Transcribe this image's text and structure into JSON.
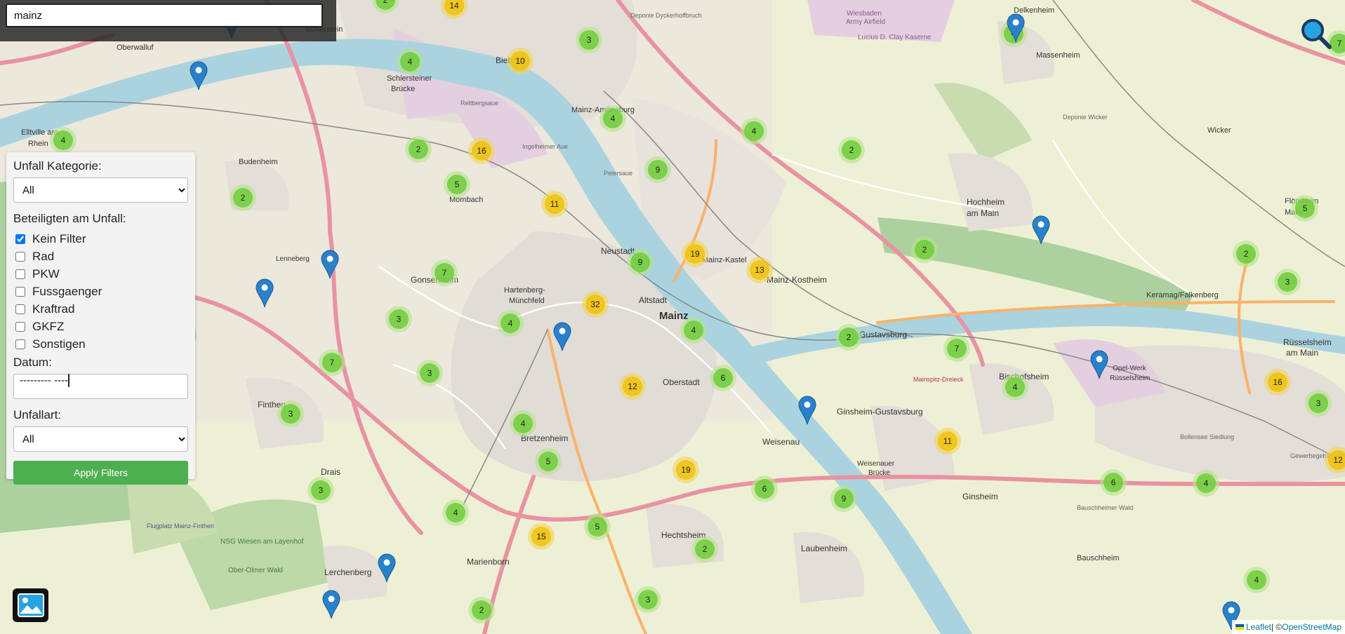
{
  "search": {
    "value": "mainz"
  },
  "filters": {
    "category_label": "Unfall Kategorie:",
    "category_value": "All",
    "participants_label": "Beteiligten am Unfall:",
    "participants": [
      {
        "label": "Kein Filter",
        "checked": true
      },
      {
        "label": "Rad",
        "checked": false
      },
      {
        "label": "PKW",
        "checked": false
      },
      {
        "label": "Fussgaenger",
        "checked": false
      },
      {
        "label": "Kraftrad",
        "checked": false
      },
      {
        "label": "GKFZ",
        "checked": false
      },
      {
        "label": "Sonstigen",
        "checked": false
      }
    ],
    "date_label": "Datum:",
    "date_placeholder": "--------- ----",
    "type_label": "Unfallart:",
    "type_value": "All",
    "apply_label": "Apply Filters"
  },
  "map": {
    "attribution_leaflet": "Leaflet",
    "attribution_sep": " | © ",
    "attribution_osm": "OpenStreetMap",
    "colors": {
      "cluster_small": "#7cc243",
      "cluster_medium": "#f0c419",
      "marker": "#2a81cb",
      "water": "#aad3df",
      "forest": "#add19e"
    },
    "clusters": [
      {
        "n": "14"
      },
      {
        "n": "2"
      },
      {
        "n": "3"
      },
      {
        "n": "10"
      },
      {
        "n": "4"
      },
      {
        "n": "4"
      },
      {
        "n": "2"
      },
      {
        "n": "4"
      },
      {
        "n": "16"
      },
      {
        "n": "4"
      },
      {
        "n": "5"
      },
      {
        "n": "9"
      },
      {
        "n": "11"
      },
      {
        "n": "2"
      },
      {
        "n": "2"
      },
      {
        "n": "19"
      },
      {
        "n": "9"
      },
      {
        "n": "7"
      },
      {
        "n": "13"
      },
      {
        "n": "32"
      },
      {
        "n": "3"
      },
      {
        "n": "4"
      },
      {
        "n": "4"
      },
      {
        "n": "7"
      },
      {
        "n": "3"
      },
      {
        "n": "12"
      },
      {
        "n": "6"
      },
      {
        "n": "3"
      },
      {
        "n": "4"
      },
      {
        "n": "5"
      },
      {
        "n": "19"
      },
      {
        "n": "6"
      },
      {
        "n": "9"
      },
      {
        "n": "11"
      },
      {
        "n": "2"
      },
      {
        "n": "7"
      },
      {
        "n": "4"
      },
      {
        "n": "3"
      },
      {
        "n": "4"
      },
      {
        "n": "15"
      },
      {
        "n": "5"
      },
      {
        "n": "2"
      },
      {
        "n": "3"
      },
      {
        "n": "2"
      },
      {
        "n": "6"
      },
      {
        "n": "4"
      },
      {
        "n": "2"
      },
      {
        "n": "2"
      },
      {
        "n": "5"
      },
      {
        "n": "3"
      },
      {
        "n": "16"
      },
      {
        "n": "3"
      },
      {
        "n": "12"
      },
      {
        "n": "4"
      },
      {
        "n": "4"
      },
      {
        "n": "7"
      }
    ],
    "places": [
      "Delkenheim",
      "Massenheim",
      "Wicker",
      "Oberwalluf",
      "Elltville am Rhein",
      "Budenheim",
      "Schierstein",
      "Schiersteiner Brücke",
      "Mainz-Amöneburg",
      "Mombach",
      "Hochheim am Main",
      "Flörsheim am Main",
      "Neustadt",
      "Mainz-Kastel",
      "Mainz-Kostheim",
      "Hartenberg-Münchfeld",
      "Altstadt",
      "Mainz",
      "Gonsenheim",
      "Keramag/Falkenberg",
      "Rüsselsheim am Main",
      "Oberstadt",
      "Gustavsburg",
      "Bischofsheim",
      "Finthen",
      "Bretzenheim",
      "Weisenau",
      "Ginsheim-Gustavsburg",
      "Opel-Werk Rüsselsheim",
      "Drais",
      "Ginsheim",
      "Weisenauer Brücke",
      "Marienborn",
      "Hechtsheim",
      "Laubenheim",
      "Bauschheim",
      "Lerchenberg",
      "Lenneberg",
      "Wiesbaden Army Airfield Lucius D. Clay Kaserne",
      "Deponie Dyckerhoffbruch",
      "Deponie Wicker",
      "NSG Wiesen am Layenhof Ober-Olmer Wald",
      "Flugplatz Mainz-Finthen",
      "Bollensee Siedlung",
      "Gewerbegebiet Hasengrund",
      "Bauschheimer Wald",
      "Ingelheimer Aue",
      "Petersaue",
      "Rettbergsaue",
      "Biebrich",
      "Mainspitz-Dreieck"
    ]
  }
}
